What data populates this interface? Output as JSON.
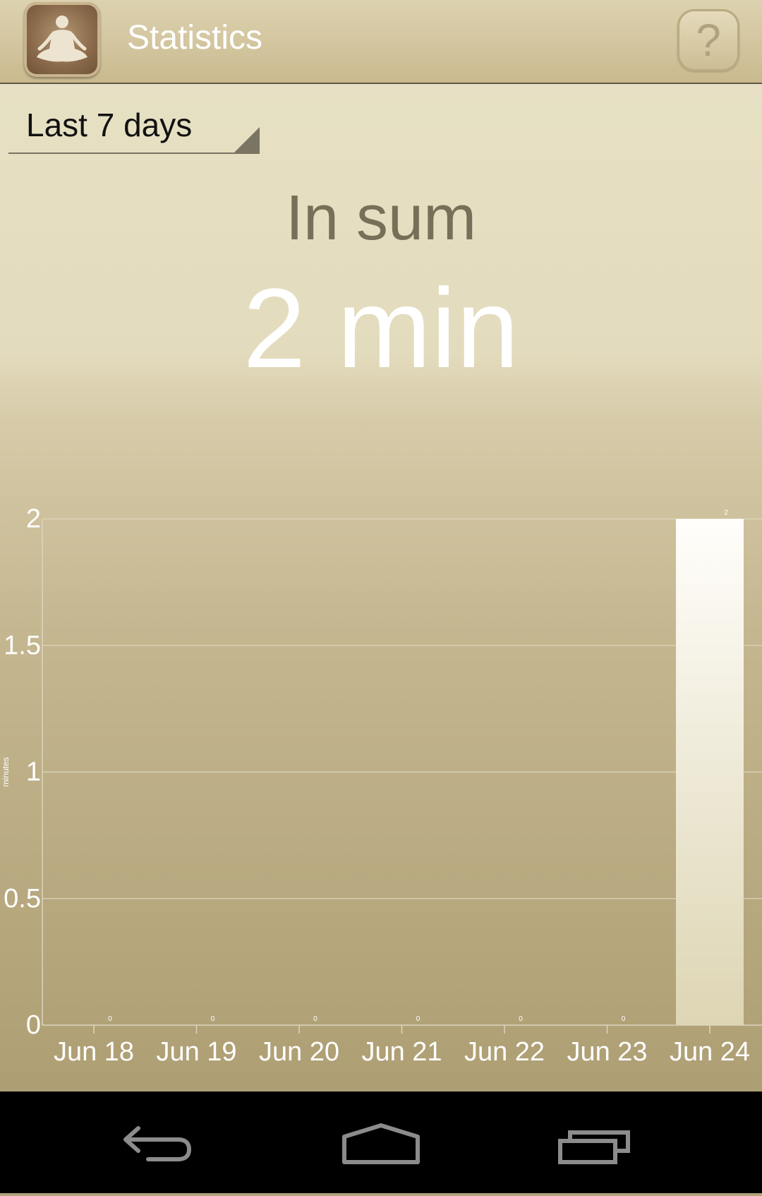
{
  "header": {
    "title": "Statistics",
    "app_icon": "meditation-figure-icon",
    "help_label": "?"
  },
  "period_select": {
    "selected": "Last 7 days"
  },
  "summary": {
    "label": "In sum",
    "value": "2 min"
  },
  "chart_data": {
    "type": "bar",
    "categories": [
      "Jun 18",
      "Jun 19",
      "Jun 20",
      "Jun 21",
      "Jun 22",
      "Jun 23",
      "Jun 24"
    ],
    "values": [
      0,
      0,
      0,
      0,
      0,
      0,
      2
    ],
    "data_labels": [
      "0",
      "0",
      "0",
      "0",
      "0",
      "0",
      "2"
    ],
    "ylabel": "minutes",
    "xlabel": "",
    "ylim": [
      0,
      2
    ],
    "yticks": [
      "0",
      "0.5",
      "1",
      "1.5",
      "2"
    ],
    "grid": true
  },
  "nav": {
    "back": "back-icon",
    "home": "home-icon",
    "recents": "recent-apps-icon"
  },
  "colors": {
    "bar_top": "#fffefb",
    "bar_bottom": "#ddd5b3",
    "grid": "#dcd5bd",
    "axis_text": "#ffffff"
  }
}
